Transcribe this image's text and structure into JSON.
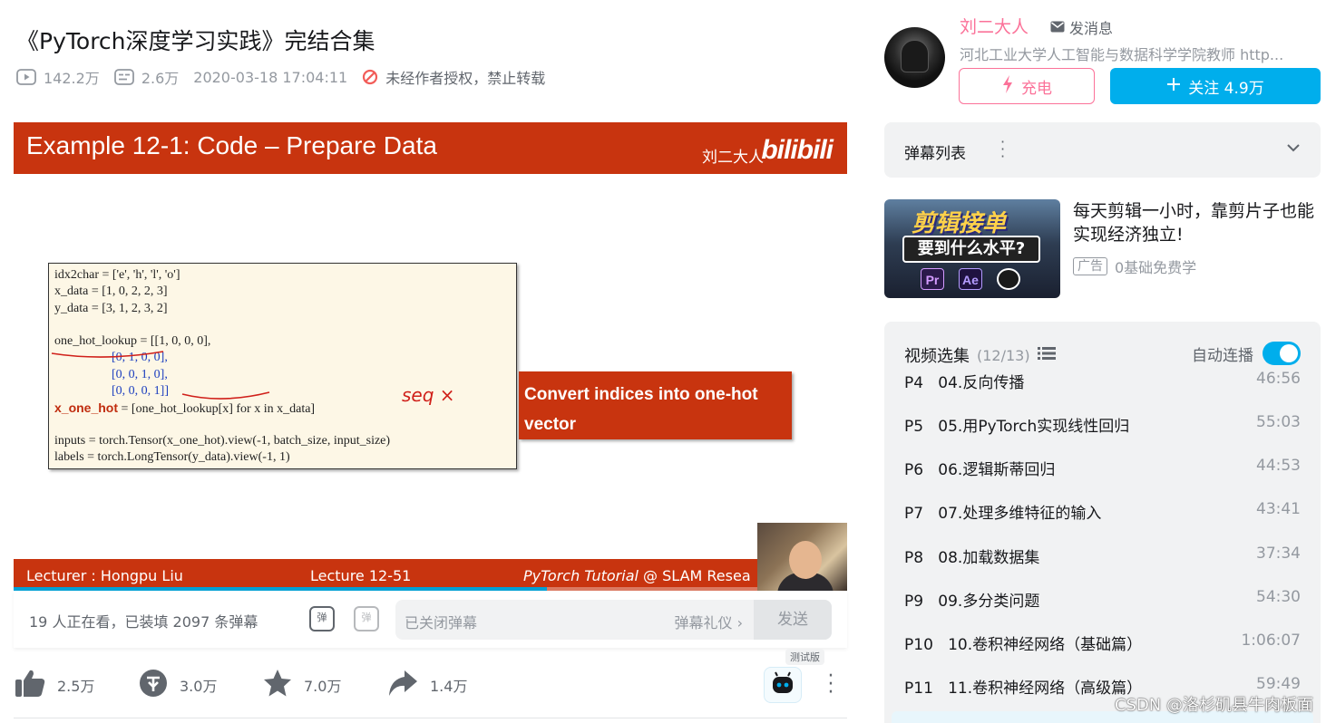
{
  "video": {
    "title": "《PyTorch深度学习实践》完结合集",
    "views": "142.2万",
    "danmaku_count": "2.6万",
    "publish_time": "2020-03-18 17:04:11",
    "rights_notice": "未经作者授权，禁止转载"
  },
  "slide": {
    "title": "Example 12-1: Code – Prepare Data",
    "author": "刘二大人",
    "logo": "bilibili",
    "code_lines": [
      "idx2char = ['e', 'h', 'l', 'o']",
      "x_data = [1, 0, 2, 2, 3]",
      "y_data = [3, 1, 2, 3, 2]",
      "",
      "one_hot_lookup = [[1, 0, 0, 0],",
      "                  [0, 1, 0, 0],",
      "                  [0, 0, 1, 0],",
      "                  [0, 0, 0, 1]]",
      "x_one_hot = [one_hot_lookup[x] for x in x_data]",
      "",
      "inputs = torch.Tensor(x_one_hot).view(-1, batch_size, input_size)",
      "labels = torch.LongTensor(y_data).view(-1, 1)"
    ],
    "code_bold_token": "x_one_hot",
    "code_line_8_rest": " = [one_hot_lookup[x] for x in x_data]",
    "annotation": "seq ×",
    "callout": "Convert indices into one-hot vector",
    "footer_left": "Lecturer : Hongpu Liu",
    "footer_center": "Lecture 12-51",
    "footer_right_italic": "PyTorch Tutorial",
    "footer_right_rest": " @ SLAM Resea",
    "progress": 0.64
  },
  "sendbar": {
    "viewers": "19 人正在看，已装填 2097 条弹幕",
    "dm_icon_1": "弹",
    "dm_icon_2": "弹",
    "input_placeholder": "已关闭弹幕",
    "etiquette": "弹幕礼仪 ›",
    "send": "发送"
  },
  "toolbar": {
    "like": "2.5万",
    "coin": "3.0万",
    "favorite": "7.0万",
    "share": "1.4万",
    "assistant_badge": "测试版"
  },
  "uploader": {
    "name": "刘二大人",
    "message": "发消息",
    "desc": "河北工业大学人工智能与数据科学学院教师 http...",
    "charge": "充电",
    "follow": "关注 4.9万"
  },
  "danmaku_list": {
    "label": "弹幕列表"
  },
  "ad": {
    "thumb_title": "剪辑接单",
    "thumb_sub": "要到什么水平?",
    "apps": [
      "Pr",
      "Ae"
    ],
    "title": "每天剪辑一小时，靠剪片子也能实现经济独立!",
    "badge": "广告",
    "tag": "0基础免费学"
  },
  "playlist": {
    "title": "视频选集",
    "count": "(12/13)",
    "autoplay": "自动连播",
    "episodes": [
      {
        "p": "P4",
        "name": "04.反向传播",
        "dur": "46:56"
      },
      {
        "p": "P5",
        "name": "05.用PyTorch实现线性回归",
        "dur": "55:03"
      },
      {
        "p": "P6",
        "name": "06.逻辑斯蒂回归",
        "dur": "44:53"
      },
      {
        "p": "P7",
        "name": "07.处理多维特征的输入",
        "dur": "43:41"
      },
      {
        "p": "P8",
        "name": "08.加载数据集",
        "dur": "37:34"
      },
      {
        "p": "P9",
        "name": "09.多分类问题",
        "dur": "54:30"
      },
      {
        "p": "P10",
        "name": "10.卷积神经网络（基础篇）",
        "dur": "1:06:07"
      },
      {
        "p": "P11",
        "name": "11.卷积神经网络（高级篇）",
        "dur": "59:49"
      }
    ]
  },
  "watermark": "CSDN @洛杉矶县牛肉板面",
  "colors": {
    "accent": "#00aeec",
    "pink": "#fb7299",
    "slide_red": "#c8340f"
  }
}
